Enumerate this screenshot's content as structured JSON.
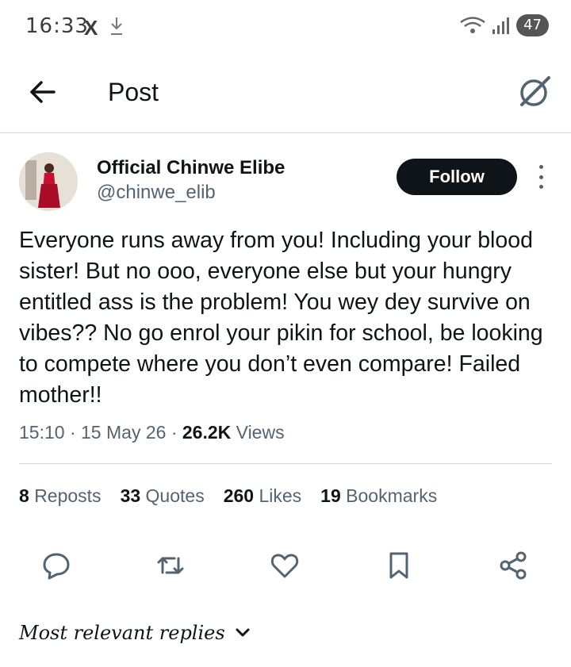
{
  "status_bar": {
    "time": "16:33",
    "x_icon": "X",
    "battery": "47"
  },
  "header": {
    "title": "Post"
  },
  "author": {
    "name": "Official Chinwe Elibe",
    "handle": "@chinwe_elib",
    "follow_label": "Follow"
  },
  "post": {
    "text": "Everyone runs away from you! Including your blood sister! But no ooo, everyone else but your hungry entitled ass is the problem! You wey dey survive on vibes?? No go enrol your pikin for school, be looking to compete where you don’t even compare! Failed mother!!",
    "time": "15:10",
    "date": "15 May 26",
    "views_count": "26.2K",
    "views_label": "Views"
  },
  "stats": {
    "reposts_count": "8",
    "reposts_label": "Reposts",
    "quotes_count": "33",
    "quotes_label": "Quotes",
    "likes_count": "260",
    "likes_label": "Likes",
    "bookmarks_count": "19",
    "bookmarks_label": "Bookmarks"
  },
  "replies": {
    "sort_label": "Most relevant replies"
  },
  "icons": {
    "back": "arrow-left-icon",
    "grok": "grok-icon",
    "reply": "reply-icon",
    "repost": "repost-icon",
    "like": "heart-icon",
    "bookmark": "bookmark-icon",
    "share": "share-icon"
  },
  "colors": {
    "text": "#0f1419",
    "secondary": "#536471",
    "follow_bg": "#0f1419",
    "divider": "#d6d9db"
  }
}
